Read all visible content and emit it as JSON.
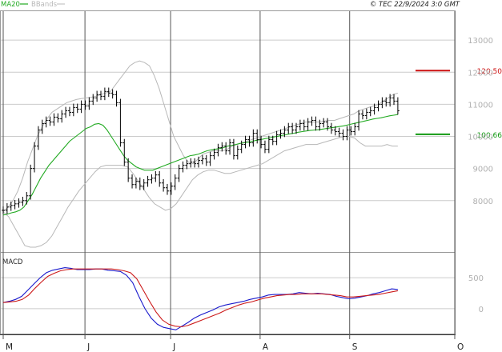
{
  "legend": {
    "ma20": "MA20",
    "bbands": "BBands"
  },
  "copyright": "© TEC 22/9/2024 3:0 GMT",
  "macd_label": "MACD",
  "colors": {
    "ma20": "#22aa22",
    "bbands": "#b8b8b8",
    "price": "#000000",
    "macd": "#1a1acc",
    "signal": "#cc1a1a",
    "resistance": "#cc1111",
    "support": "#119911",
    "grid": "#cccccc",
    "axis_text": "#b0b0b0"
  },
  "chart_data": [
    {
      "type": "ohlc",
      "y_ticks": [
        {
          "value": 8000,
          "label": "8000"
        },
        {
          "value": 9000,
          "label": "9000"
        },
        {
          "value": 10000,
          "label": "10000"
        },
        {
          "value": 11000,
          "label": "11000"
        },
        {
          "value": 12000,
          "label": "12000"
        },
        {
          "value": 13000,
          "label": "13000"
        }
      ],
      "ylim": [
        6400,
        13900
      ],
      "x_ticks": [
        {
          "label": "M",
          "index": 0
        },
        {
          "label": "J",
          "index": 21
        },
        {
          "label": "J",
          "index": 43
        },
        {
          "label": "A",
          "index": 66
        },
        {
          "label": "S",
          "index": 89
        },
        {
          "label": "O",
          "index": 116
        }
      ],
      "x_count": 117,
      "levels": [
        {
          "name": "resistance",
          "value": 12050,
          "label": "120.50"
        },
        {
          "name": "support",
          "value": 10066,
          "label": "100.66"
        }
      ],
      "close": [
        7700,
        7800,
        7850,
        7900,
        7950,
        8000,
        8150,
        9000,
        9700,
        10200,
        10400,
        10500,
        10450,
        10600,
        10550,
        10700,
        10800,
        10750,
        10900,
        10850,
        11000,
        10950,
        11100,
        11200,
        11300,
        11250,
        11400,
        11350,
        11300,
        11050,
        9800,
        9200,
        8700,
        8500,
        8600,
        8450,
        8550,
        8650,
        8700,
        8800,
        8550,
        8400,
        8300,
        8450,
        8700,
        9000,
        9100,
        9150,
        9200,
        9150,
        9250,
        9300,
        9200,
        9400,
        9500,
        9650,
        9700,
        9550,
        9800,
        9400,
        9600,
        9750,
        9900,
        9800,
        10100,
        9900,
        9750,
        9600,
        9900,
        9850,
        10050,
        10100,
        10200,
        10300,
        10200,
        10300,
        10400,
        10300,
        10450,
        10500,
        10300,
        10400,
        10450,
        10300,
        10200,
        10150,
        10100,
        10000,
        10200,
        10150,
        10300,
        10700,
        10650,
        10750,
        10800,
        10900,
        11000,
        11100,
        11050,
        11200,
        11100,
        10800
      ],
      "ma20": [
        7550,
        7580,
        7620,
        7650,
        7700,
        7800,
        8000,
        8200,
        8450,
        8700,
        8900,
        9100,
        9250,
        9400,
        9550,
        9700,
        9850,
        9950,
        10050,
        10150,
        10250,
        10300,
        10380,
        10400,
        10350,
        10200,
        10000,
        9800,
        9600,
        9400,
        9250,
        9150,
        9050,
        9000,
        8950,
        8950,
        8950,
        9000,
        9050,
        9100,
        9150,
        9200,
        9250,
        9300,
        9350,
        9400,
        9420,
        9450,
        9500,
        9550,
        9580,
        9600,
        9620,
        9650,
        9700,
        9720,
        9750,
        9780,
        9800,
        9820,
        9850,
        9880,
        9900,
        9930,
        9950,
        9980,
        10000,
        10030,
        10050,
        10080,
        10100,
        10130,
        10150,
        10170,
        10190,
        10200,
        10210,
        10230,
        10250,
        10270,
        10290,
        10310,
        10330,
        10360,
        10390,
        10420,
        10450,
        10480,
        10510,
        10540,
        10560,
        10580,
        10610,
        10640,
        10660,
        10680
      ],
      "bb_upper": [
        7650,
        7800,
        8000,
        8300,
        8700,
        9200,
        9600,
        10000,
        10300,
        10550,
        10750,
        10850,
        10950,
        11050,
        11100,
        11150,
        11180,
        11200,
        11220,
        11250,
        11300,
        11350,
        11400,
        11600,
        11800,
        12000,
        12200,
        12300,
        12350,
        12300,
        12200,
        11900,
        11500,
        11000,
        10500,
        10000,
        9700,
        9400,
        9200,
        9150,
        9300,
        9450,
        9500,
        9550,
        9550,
        9550,
        9600,
        9700,
        9750,
        9800,
        9850,
        9900,
        9950,
        10000,
        10050,
        10100,
        10150,
        10200,
        10250,
        10300,
        10350,
        10400,
        10450,
        10450,
        10450,
        10450,
        10480,
        10500,
        10500,
        10550,
        10600,
        10650,
        10700,
        10800,
        10850,
        10900,
        10950,
        11000,
        11100,
        11200,
        11300,
        11350
      ],
      "bb_lower": [
        7650,
        7500,
        7200,
        6900,
        6600,
        6550,
        6550,
        6600,
        6700,
        6900,
        7200,
        7500,
        7800,
        8050,
        8300,
        8500,
        8700,
        8900,
        9050,
        9100,
        9100,
        9100,
        9100,
        9050,
        8850,
        8600,
        8350,
        8100,
        7900,
        7800,
        7700,
        7750,
        7900,
        8150,
        8400,
        8650,
        8800,
        8900,
        8950,
        8950,
        8900,
        8850,
        8850,
        8900,
        8950,
        9000,
        9050,
        9100,
        9150,
        9250,
        9350,
        9450,
        9550,
        9600,
        9650,
        9700,
        9750,
        9750,
        9750,
        9800,
        9850,
        9900,
        9950,
        10000,
        10000,
        9950,
        9800,
        9700,
        9700,
        9700,
        9700,
        9750,
        9700,
        9700
      ]
    },
    {
      "type": "line",
      "title": "MACD",
      "y_ticks": [
        {
          "value": 0,
          "label": "0"
        },
        {
          "value": 500,
          "label": "500"
        }
      ],
      "ylim": [
        -400,
        900
      ],
      "series": [
        {
          "name": "MACD",
          "values": [
            100,
            120,
            150,
            200,
            300,
            400,
            500,
            580,
            620,
            640,
            660,
            650,
            630,
            630,
            630,
            640,
            640,
            620,
            610,
            600,
            540,
            420,
            200,
            0,
            -150,
            -250,
            -300,
            -320,
            -340,
            -280,
            -220,
            -150,
            -100,
            -60,
            -20,
            30,
            60,
            80,
            100,
            120,
            150,
            170,
            190,
            220,
            230,
            230,
            230,
            240,
            260,
            250,
            240,
            250,
            240,
            230,
            200,
            180,
            160,
            170,
            190,
            210,
            240,
            260,
            290,
            320,
            310
          ]
        },
        {
          "name": "Signal",
          "values": [
            100,
            110,
            120,
            150,
            220,
            330,
            430,
            520,
            570,
            610,
            630,
            640,
            640,
            640,
            640,
            640,
            640,
            640,
            630,
            610,
            580,
            480,
            300,
            120,
            -50,
            -180,
            -250,
            -280,
            -290,
            -270,
            -230,
            -190,
            -150,
            -110,
            -70,
            -20,
            20,
            60,
            90,
            110,
            140,
            170,
            190,
            210,
            220,
            230,
            230,
            240,
            240,
            240,
            240,
            230,
            220,
            210,
            190,
            190,
            200,
            210,
            220,
            230,
            250,
            270,
            290
          ]
        }
      ]
    }
  ]
}
